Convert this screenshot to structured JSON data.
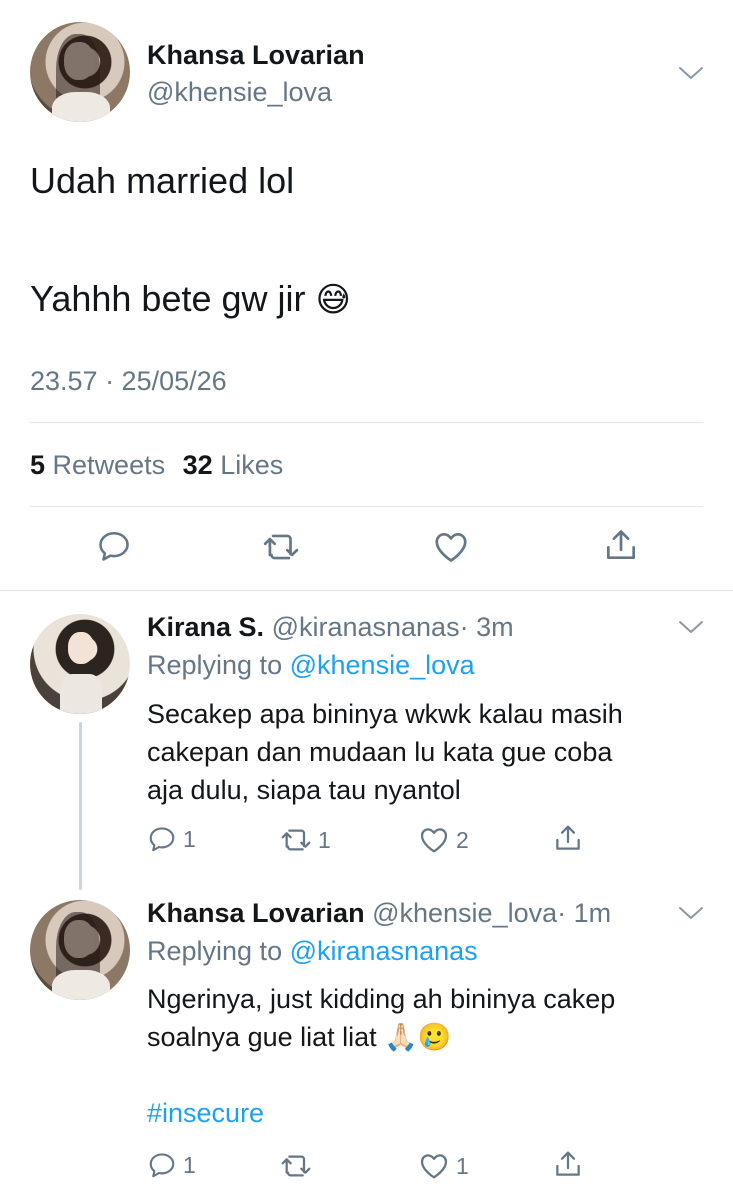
{
  "main_tweet": {
    "author_name": "Khansa Lovarian",
    "author_handle": "@khensie_lova",
    "text_line1": "Udah married lol",
    "text_line2": "Yahhh bete gw jir",
    "text_emoji": "😅",
    "timestamp": "23.57 · 25/05/26",
    "retweets_count": "5",
    "retweets_label": "Retweets",
    "likes_count": "32",
    "likes_label": "Likes"
  },
  "replies": [
    {
      "author_name": "Kirana S.",
      "author_handle": "@kiranasnanas",
      "time": "· 3m",
      "replying_label": "Replying to",
      "replying_to": "@khensie_lova",
      "text_lines": [
        "Secakep apa bininya wkwk kalau masih",
        "cakepan dan mudaan lu kata gue coba",
        "aja dulu, siapa tau nyantol"
      ],
      "reply_count": "1",
      "retweet_count": "1",
      "like_count": "2"
    },
    {
      "author_name": "Khansa Lovarian",
      "author_handle": "@khensie_lova",
      "time": "· 1m",
      "replying_label": "Replying to",
      "replying_to": "@kiranasnanas",
      "text_lines": [
        "Ngerinya, just kidding ah bininya cakep",
        "soalnya gue liat liat"
      ],
      "text_emojis": "🙏🏻🥲",
      "hashtag": "#insecure",
      "reply_count": "1",
      "retweet_count": "",
      "like_count": "1"
    }
  ],
  "colors": {
    "link": "#1da1f2",
    "secondary": "#657786",
    "divider": "#e1e8ed"
  }
}
